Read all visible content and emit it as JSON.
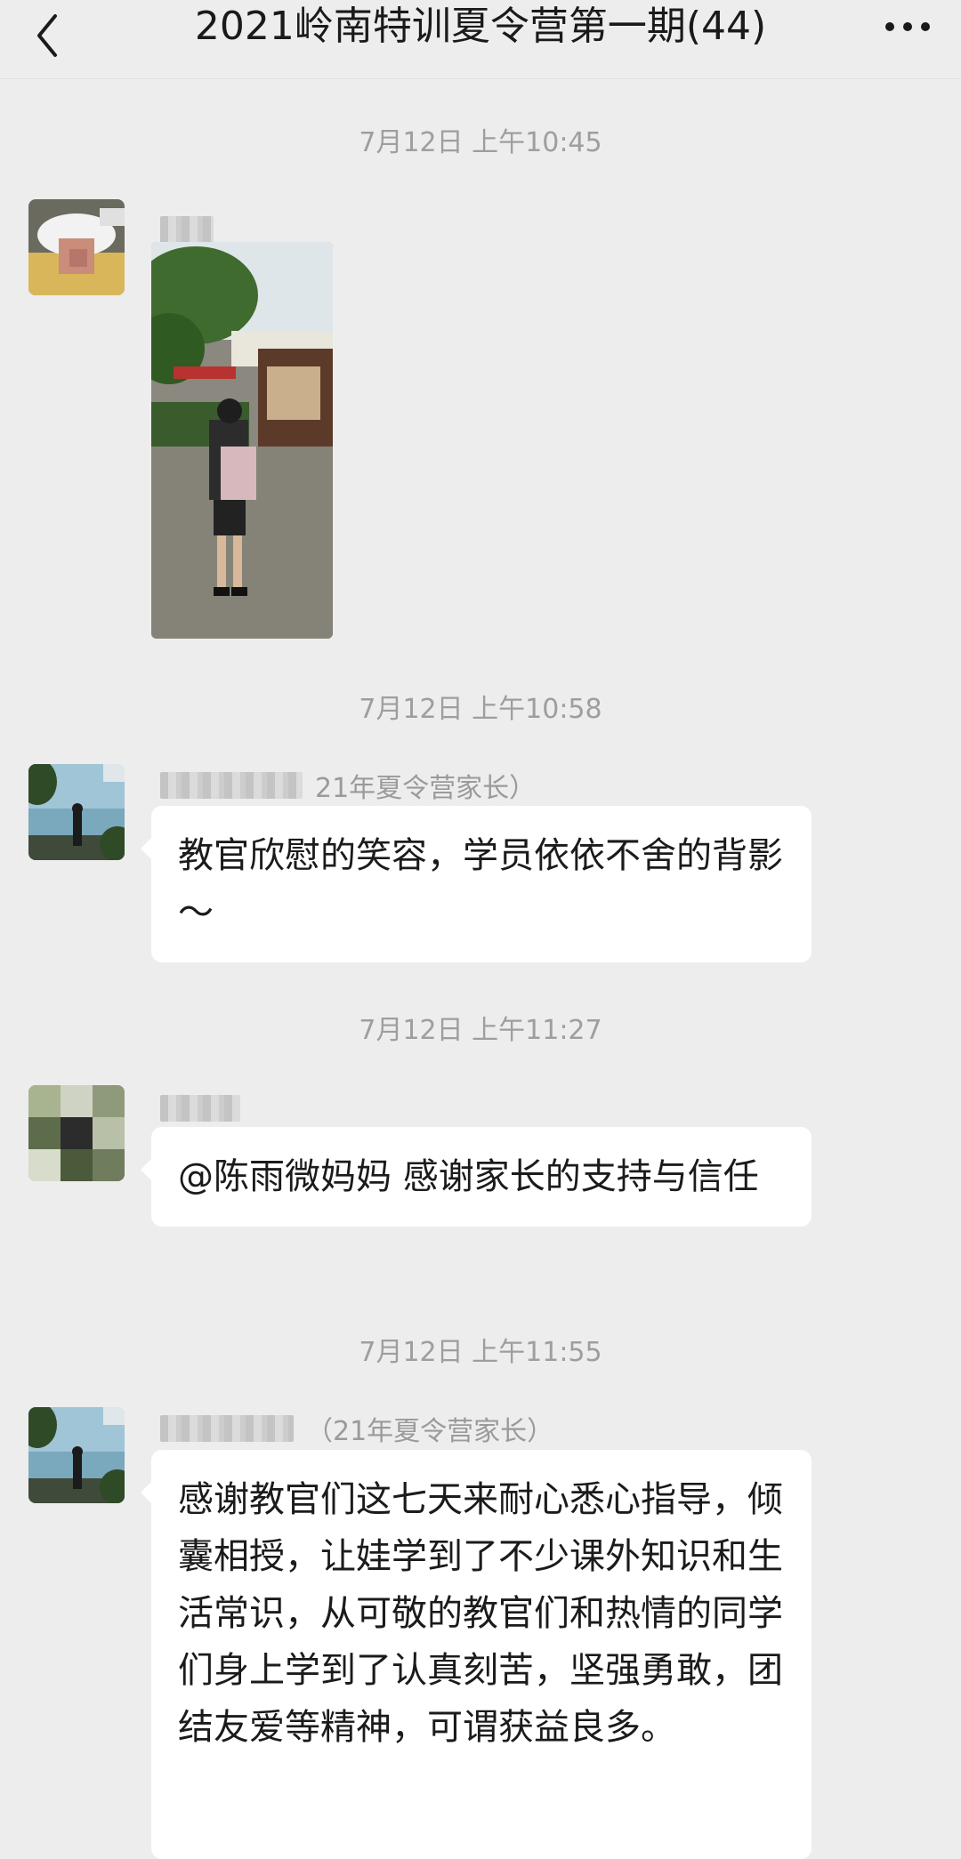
{
  "header": {
    "title": "2021岭南特训夏令营第一期(44)"
  },
  "icons": {
    "back": "chevron-left-icon",
    "more": "more-dots-icon"
  },
  "messages": [
    {
      "timestamp": "7月12日 上午10:45",
      "sender_tag": "",
      "type": "image"
    },
    {
      "timestamp": "7月12日 上午10:58",
      "sender_tag": "21年夏令营家长）",
      "type": "text",
      "text": "教官欣慰的笑容，学员依依不舍的背影～"
    },
    {
      "timestamp": "7月12日 上午11:27",
      "sender_tag": "",
      "type": "text",
      "text": "@陈雨微妈妈  感谢家长的支持与信任"
    },
    {
      "timestamp": "7月12日 上午11:55",
      "sender_tag": "（21年夏令营家长）",
      "type": "text",
      "text": "感谢教官们这七天来耐心悉心指导，倾囊相授，让娃学到了不少课外知识和生活常识，从可敬的教官们和热情的同学们身上学到了认真刻苦，坚强勇敢，团结友爱等精神，可谓获益良多。"
    }
  ]
}
